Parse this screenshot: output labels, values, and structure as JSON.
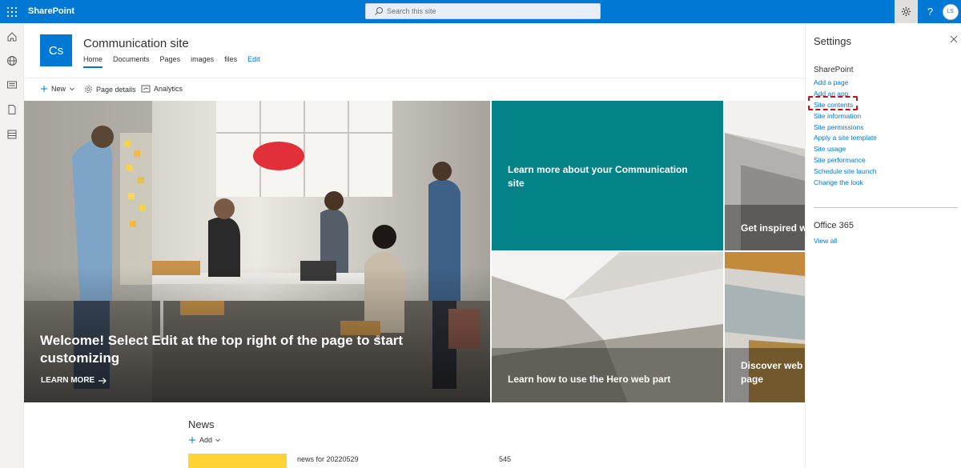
{
  "suite": {
    "app_name": "SharePoint",
    "search_placeholder": "Search this site",
    "avatar_initials": "LS",
    "accent": "#0078d4"
  },
  "site": {
    "logo_initials": "Cs",
    "title": "Communication site",
    "nav": [
      {
        "label": "Home",
        "active": true
      },
      {
        "label": "Documents"
      },
      {
        "label": "Pages"
      },
      {
        "label": "images"
      },
      {
        "label": "files"
      },
      {
        "label": "Edit"
      }
    ]
  },
  "commands": {
    "new": "New",
    "page_details": "Page details",
    "analytics": "Analytics"
  },
  "hero": {
    "main_text": "Welcome! Select Edit at the top right of the page to start customizing",
    "learn_more": "LEARN MORE",
    "teal_text": "Learn more about your Communication site",
    "right1_text": "Get inspired w",
    "mid2_text": "Learn how to use the Hero web part",
    "right2_text": "Discover web page",
    "teal_color": "#038387"
  },
  "news": {
    "title": "News",
    "add": "Add",
    "item_title": "news for 20220529",
    "item_count": "545"
  },
  "settings": {
    "title": "Settings",
    "sharepoint_head": "SharePoint",
    "links": [
      "Add a page",
      "Add an app",
      "Site contents",
      "Site information",
      "Site permissions",
      "Apply a site template",
      "Site usage",
      "Site performance",
      "Schedule site launch",
      "Change the look"
    ],
    "office_head": "Office 365",
    "view_all": "View all",
    "highlight_color": "#c50f1f"
  }
}
